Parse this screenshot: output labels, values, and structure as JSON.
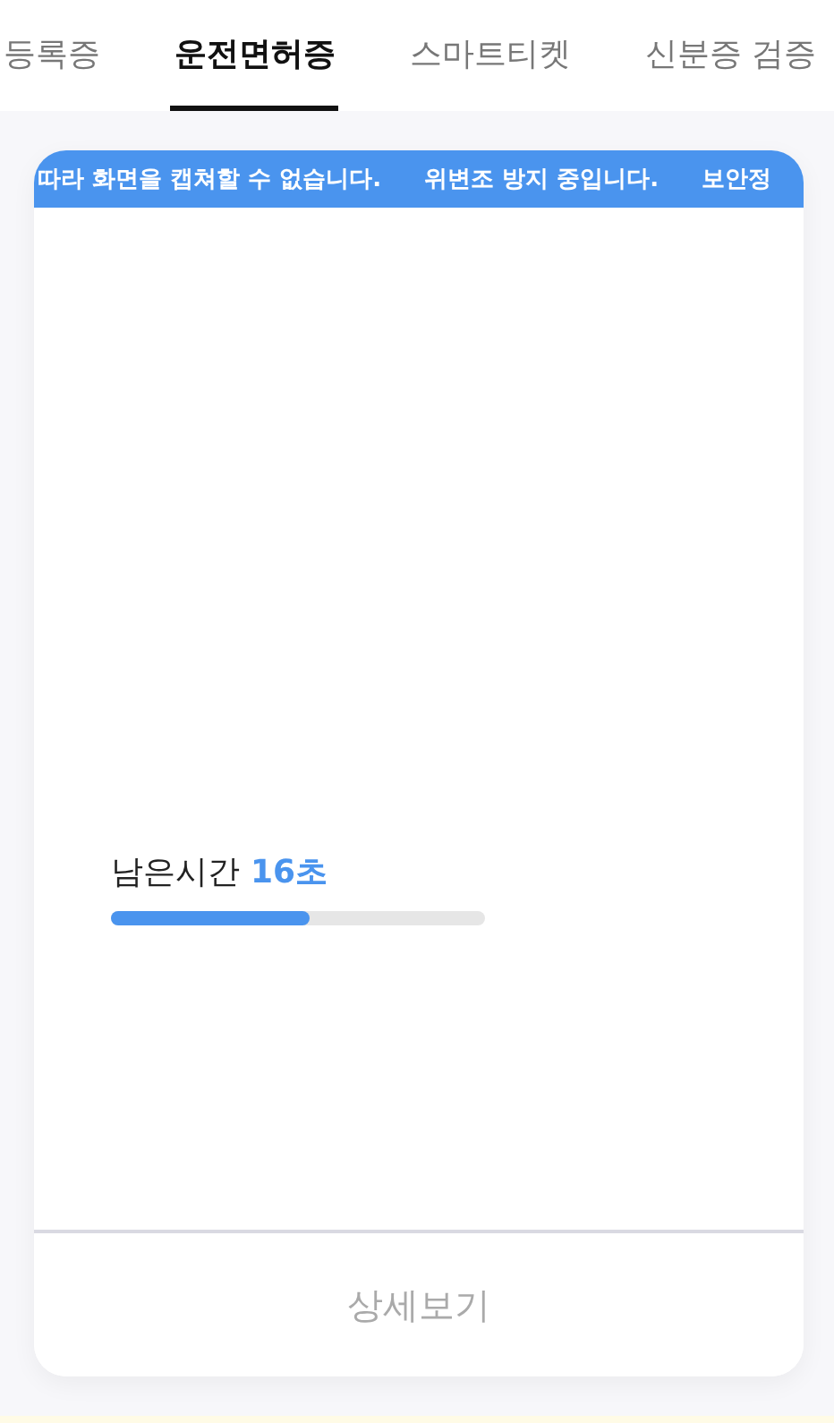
{
  "tabs": [
    {
      "label": "등록증",
      "selected": false
    },
    {
      "label": "운전면허증",
      "selected": true
    },
    {
      "label": "스마트티켓",
      "selected": false
    },
    {
      "label": "신분증 검증",
      "selected": false
    }
  ],
  "card": {
    "banner": [
      "따라 화면을 캡쳐할 수 없습니다.",
      "위변조 방지 중입니다.",
      "보안정"
    ],
    "timer": {
      "label": "남은시간",
      "value": "16초",
      "level": 0.53
    },
    "detail_button": "상세보기"
  }
}
